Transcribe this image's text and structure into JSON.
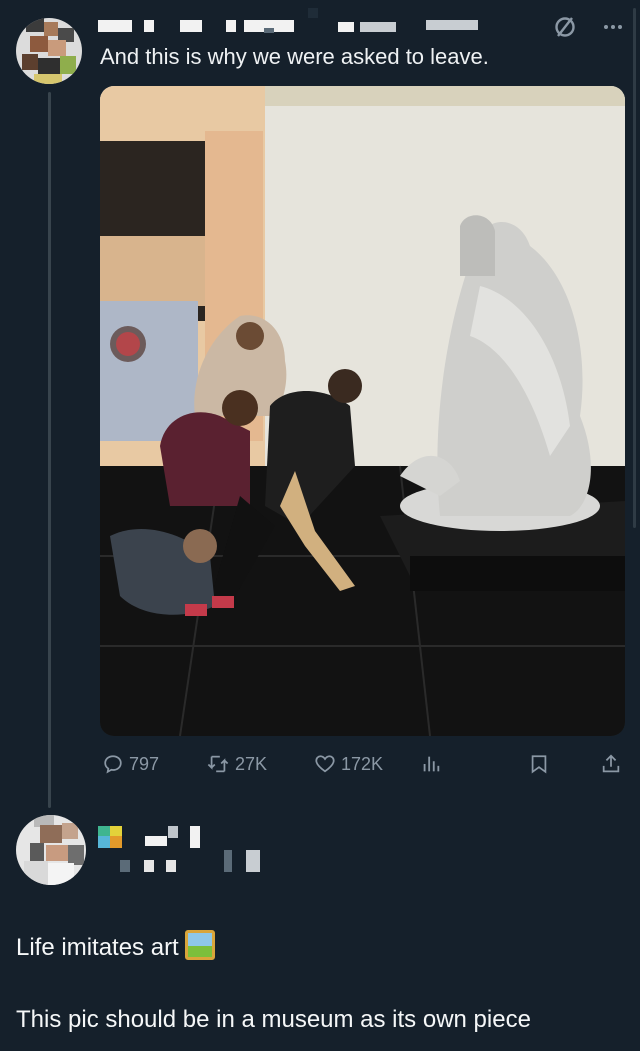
{
  "tweet": {
    "text": "And this is why we were asked to leave."
  },
  "stats": {
    "replies": "797",
    "reposts": "27K",
    "likes": "172K"
  },
  "reply": {
    "line1": "Life imitates art",
    "line2": "This pic should be in a museum as its own piece"
  },
  "icons": {
    "grok": "slashed-circle-icon",
    "more": "more-dots-icon",
    "reply": "comment-icon",
    "repost": "repost-icon",
    "like": "heart-icon",
    "views": "bar-chart-icon",
    "bookmark": "bookmark-icon",
    "share": "share-icon",
    "emoji": "framed-picture-emoji"
  },
  "colors": {
    "background": "#15202b",
    "text": "#e7e9ea",
    "muted": "#8b98a5",
    "thread_line": "#38444d"
  }
}
